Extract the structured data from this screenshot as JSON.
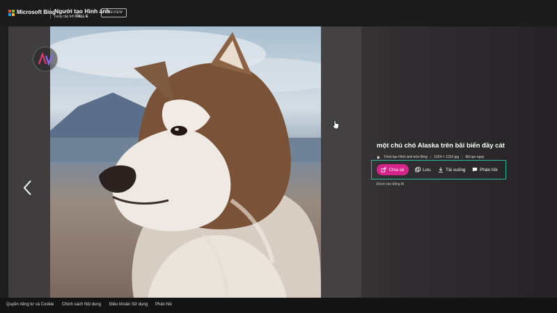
{
  "header": {
    "brand": "Microsoft Bing",
    "product_title": "Người tạo Hình ảnh",
    "product_sub_prefix": "cung cấp bởi",
    "product_sub_engine": "DALL·E",
    "preview_badge": "PREVIEW"
  },
  "viewer": {
    "caption": "một chú chó Alaska trên bãi biển đầy cát",
    "meta": {
      "source": "Trình tạo Hình ảnh trên Bing",
      "dimensions": "1024 × 1024 jpg",
      "created": "Đã tạo ngay"
    },
    "actions": {
      "share": "Chia sẻ",
      "save": "Lưu",
      "download": "Tải xuống",
      "feedback": "Phản hồi"
    },
    "ai_note": "Được tạo bằng AI"
  },
  "footer": {
    "links": [
      "Quyền riêng tư và Cookie",
      "Chính sách Nội dung",
      "Điều khoản Sử dụng",
      "Phản hồi"
    ]
  },
  "colors": {
    "accent_share": "#d6248a",
    "focus_outline": "#29bca6"
  },
  "icons": {
    "brand": "microsoft-logo",
    "overlay_logo": "av-watermark",
    "prev": "chevron-left-icon",
    "share": "share-icon",
    "save": "save-icon",
    "download": "download-icon",
    "feedback": "feedback-icon",
    "meta": "image-creator-icon"
  }
}
